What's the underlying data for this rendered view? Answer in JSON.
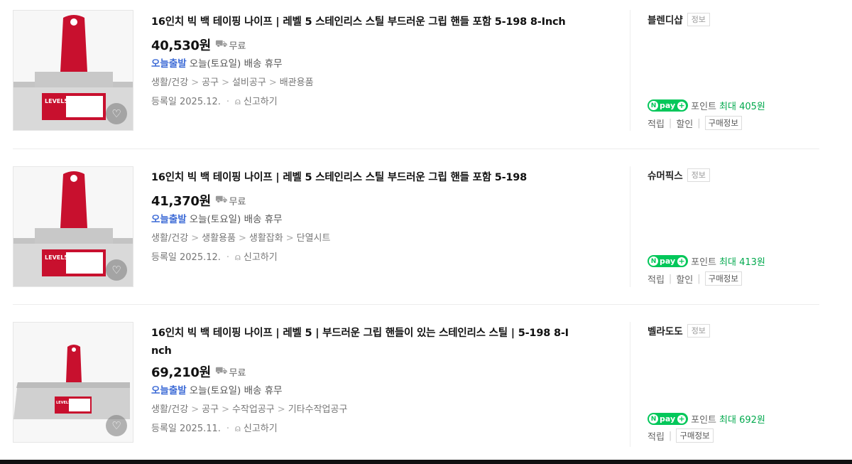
{
  "products": [
    {
      "title": "16인치 빅 백 테이핑 나이프 | 레벨 5 스테인리스 스틸 부드러운 그립 핸들 포함 5-198 8-Inch",
      "price": "40,530원",
      "shipping": "무료",
      "today_label": "오늘출발",
      "today_text": "오늘(토요일) 배송 휴무",
      "categories": [
        "생활/건강",
        "공구",
        "설비공구",
        "배관용품"
      ],
      "registered": "등록일 2025.12.",
      "report": "신고하기",
      "seller": "블렌디샵",
      "seller_tag": "정보",
      "point_label": "포인트",
      "point_max": "최대 405원",
      "bottom_links": [
        "적립",
        "할인"
      ],
      "buy_info": "구매정보"
    },
    {
      "title": "16인치 빅 백 테이핑 나이프 | 레벨 5 스테인리스 스틸 부드러운 그립 핸들 포함 5-198",
      "price": "41,370원",
      "shipping": "무료",
      "today_label": "오늘출발",
      "today_text": "오늘(토요일) 배송 휴무",
      "categories": [
        "생활/건강",
        "생활용품",
        "생활잡화",
        "단열시트"
      ],
      "registered": "등록일 2025.12.",
      "report": "신고하기",
      "seller": "슈머픽스",
      "seller_tag": "정보",
      "point_label": "포인트",
      "point_max": "최대 413원",
      "bottom_links": [
        "적립",
        "할인"
      ],
      "buy_info": "구매정보"
    },
    {
      "title": "16인치 빅 백 테이핑 나이프 | 레벨 5 | 부드러운 그립 핸들이 있는 스테인리스 스틸 | 5-198 8-I",
      "title_line2": "nch",
      "price": "69,210원",
      "shipping": "무료",
      "today_label": "오늘출발",
      "today_text": "오늘(토요일) 배송 휴무",
      "categories": [
        "생활/건강",
        "공구",
        "수작업공구",
        "기타수작업공구"
      ],
      "registered": "등록일 2025.11.",
      "report": "신고하기",
      "seller": "벨라도도",
      "seller_tag": "정보",
      "point_label": "포인트",
      "point_max": "최대 692원",
      "bottom_links": [
        "적립"
      ],
      "buy_info": "구매정보"
    }
  ],
  "npay_text": "pay",
  "product_image_brand": "LEVEL5",
  "icons": {
    "heart": "heart-icon",
    "truck": "truck-icon",
    "bell": "siren-icon"
  },
  "colors": {
    "today": "#3d6bd6",
    "npay": "#03c75a",
    "point_max": "#03a94e",
    "handle": "#c8102e"
  }
}
